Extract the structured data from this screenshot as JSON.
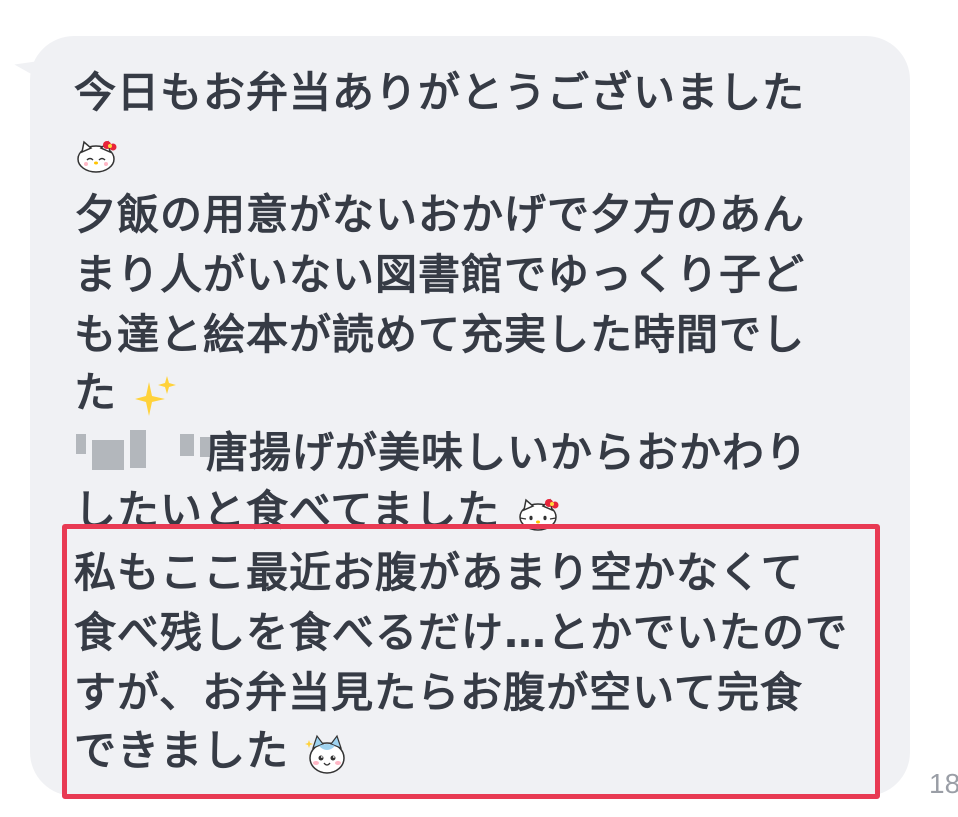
{
  "message": {
    "lines": [
      "今日もお弁当ありがとうございました",
      "",
      "夕飯の用意がないおかげで夕方のあん",
      "まり人がいない図書館でゆっくり子ど",
      "も達と絵本が読めて充実した時間でし",
      "た",
      "唐揚げが美味しいからおかわり",
      "したいと食べてました",
      "私もここ最近お腹があまり空かなくて",
      "食べ残しを食べるだけ…とかでいたので",
      "すが、お弁当見たらお腹が空いて完食",
      "できました"
    ],
    "emoji": {
      "line2": "hello-kitty-emoji",
      "line6": "sparkles-emoji",
      "line8": "hello-kitty-emoji",
      "line12": "chiikawa-hachiware-emoji"
    }
  },
  "timestamp": "18",
  "colors": {
    "bubble": "#f0f1f4",
    "text": "#363b45",
    "highlight_border": "#e83a53",
    "timestamp": "#9a9ea6"
  }
}
